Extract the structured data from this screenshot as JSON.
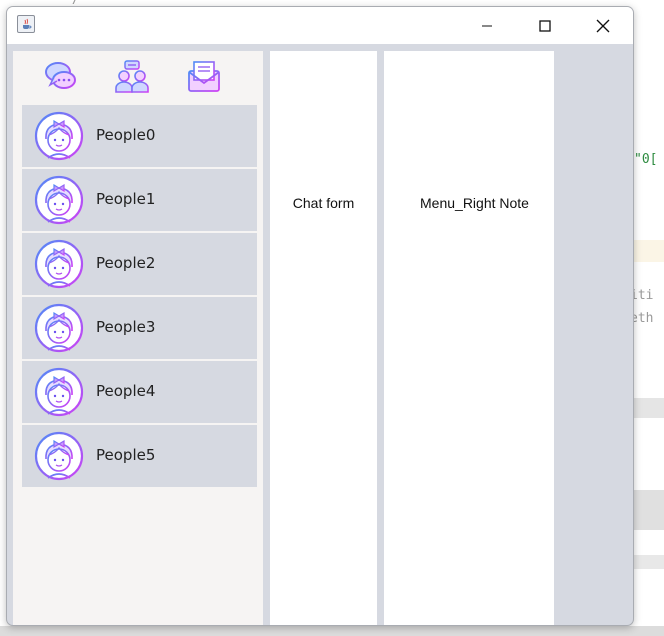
{
  "ide": {
    "top_comment": "*/",
    "line1": "\"0[",
    "line2": "iti",
    "line3": "eth"
  },
  "window": {
    "title": "",
    "icons": {
      "app": "java-icon",
      "minimize": "minimize-icon",
      "maximize": "maximize-icon",
      "close": "close-icon"
    }
  },
  "toolbar": {
    "icons": [
      "chat-bubbles-icon",
      "people-chat-icon",
      "mail-icon"
    ]
  },
  "contacts": [
    {
      "name": "People0"
    },
    {
      "name": "People1"
    },
    {
      "name": "People2"
    },
    {
      "name": "People3"
    },
    {
      "name": "People4"
    },
    {
      "name": "People5"
    }
  ],
  "panels": {
    "chat_form": "Chat form",
    "right_note": "Menu_Right Note"
  },
  "colors": {
    "contact_bg": "#d6d9e1",
    "window_bg": "#d6d9e1",
    "left_panel_bg": "#f6f4f3",
    "icon_gradient_start": "#4f8cf6",
    "icon_gradient_end": "#d040f5"
  }
}
